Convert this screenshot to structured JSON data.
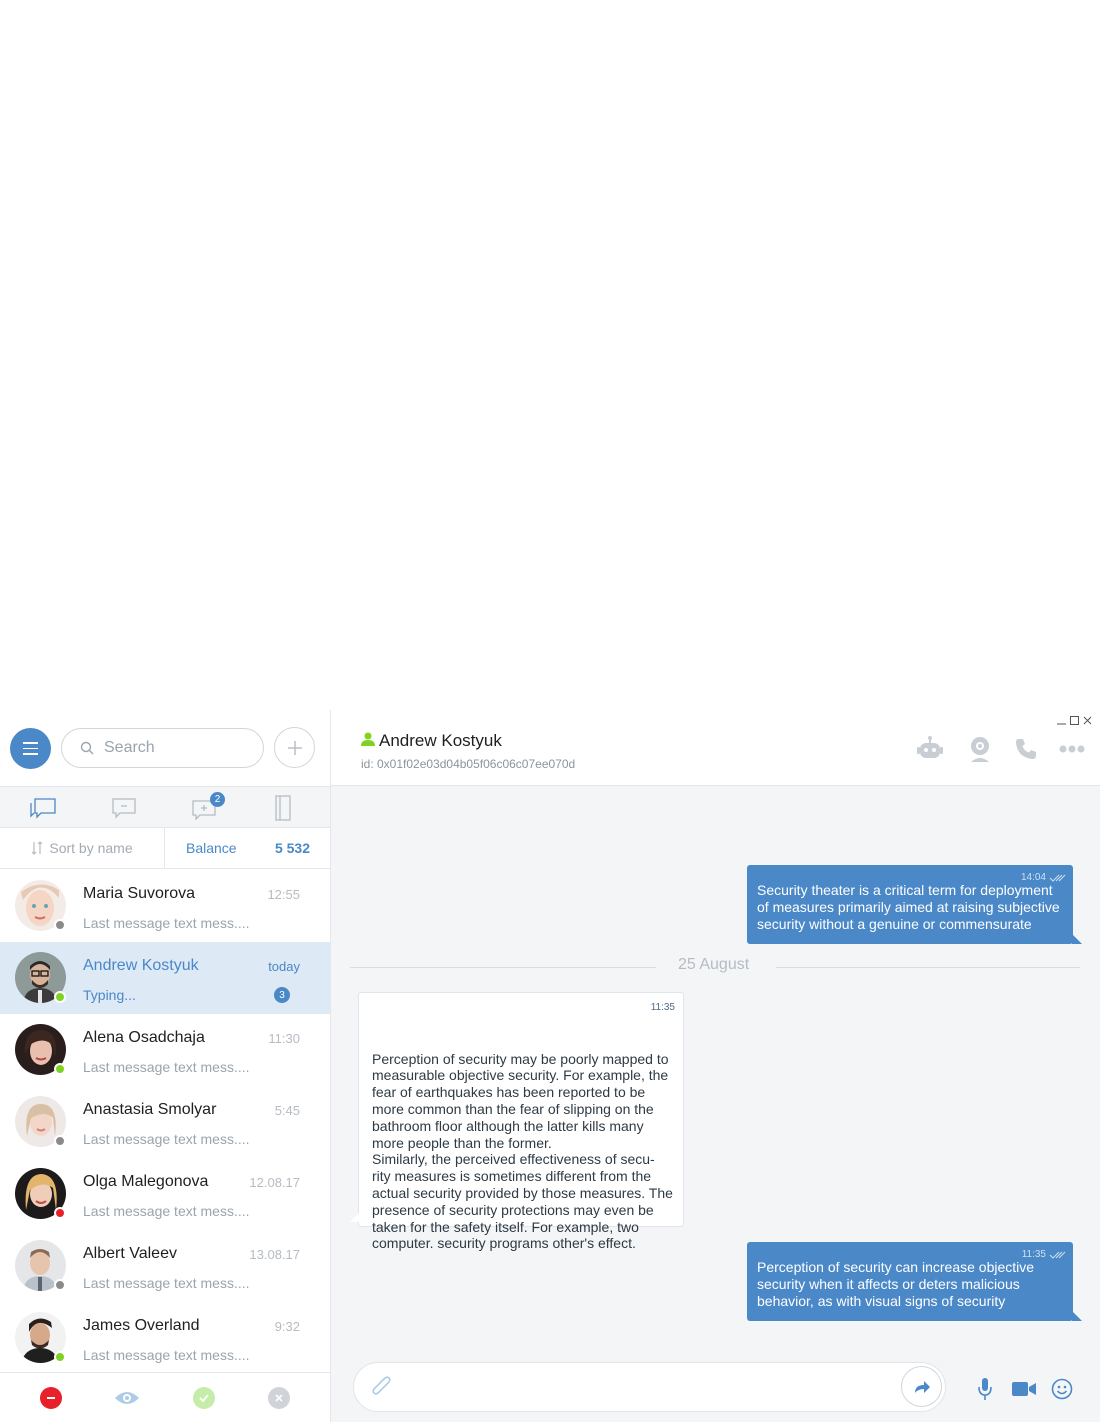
{
  "sidebar": {
    "search_placeholder": "Search",
    "tabs": [
      {
        "name": "chats",
        "badge": ""
      },
      {
        "name": "messages",
        "badge": ""
      },
      {
        "name": "group-chats",
        "badge": "2"
      },
      {
        "name": "contacts-book",
        "badge": ""
      }
    ],
    "sort_label": "Sort by name",
    "balance_label": "Balance",
    "balance_value": "5 532",
    "contacts": [
      {
        "name": "Maria Suvorova",
        "time": "12:55",
        "message": "Last message text mess....",
        "status": "offline",
        "status_color": "#8a8a8a",
        "unread": "",
        "active": false
      },
      {
        "name": "Andrew Kostyuk",
        "time": "today",
        "message": "Typing...",
        "status": "online",
        "status_color": "#7ed321",
        "unread": "3",
        "active": true
      },
      {
        "name": "Alena Osadchaja",
        "time": "11:30",
        "message": "Last message text mess....",
        "status": "online",
        "status_color": "#7ed321",
        "unread": "",
        "active": false
      },
      {
        "name": "Anastasia Smolyar",
        "time": "5:45",
        "message": "Last message text mess....",
        "status": "offline",
        "status_color": "#8a8a8a",
        "unread": "",
        "active": false
      },
      {
        "name": "Olga Malegonova",
        "time": "12.08.17",
        "message": "Last message text mess....",
        "status": "busy",
        "status_color": "#e8202a",
        "unread": "",
        "active": false
      },
      {
        "name": "Albert Valeev",
        "time": "13.08.17",
        "message": "Last message text mess....",
        "status": "offline",
        "status_color": "#8a8a8a",
        "unread": "",
        "active": false
      },
      {
        "name": "James Overland",
        "time": "9:32",
        "message": "Last message text mess....",
        "status": "online",
        "status_color": "#7ed321",
        "unread": "",
        "active": false
      }
    ],
    "status_buttons": [
      "do-not-disturb",
      "invisible",
      "online",
      "offline"
    ]
  },
  "chat": {
    "contact_name": "Andrew Kostyuk",
    "contact_id": "id: 0x01f02e03d04b05f06c06c07ee070d",
    "presence_color": "#7ed321",
    "date_separator": "25 August",
    "messages": [
      {
        "direction": "out",
        "time": "14:04",
        "text": "Security theater is a critical term for deployment of measures primarily aimed at raising subjective security without a genuine or commensurate"
      },
      {
        "direction": "in",
        "time": "11:35",
        "text": "Perception of security may be poorly mapped to measurable objective security. For example, the fear of earthquakes has been reported to be more common than the fear of slipping on the bathroom floor although the latter kills many more people than the former.\nSimilarly, the perceived effectiveness of secu-rity measures is sometimes different from the actual security provided by those measures. The presence of security protections may even be taken for the safety itself. For example, two computer. security programs other's effect."
      },
      {
        "direction": "out",
        "time": "11:35",
        "text": "Perception of security can increase objective security when it affects or deters malicious behavior, as with visual signs of security"
      }
    ],
    "composer_placeholder": ""
  },
  "colors": {
    "accent": "#4a88c8",
    "online": "#7ed321",
    "busy": "#e8202a",
    "offline": "#8a8a8a"
  }
}
